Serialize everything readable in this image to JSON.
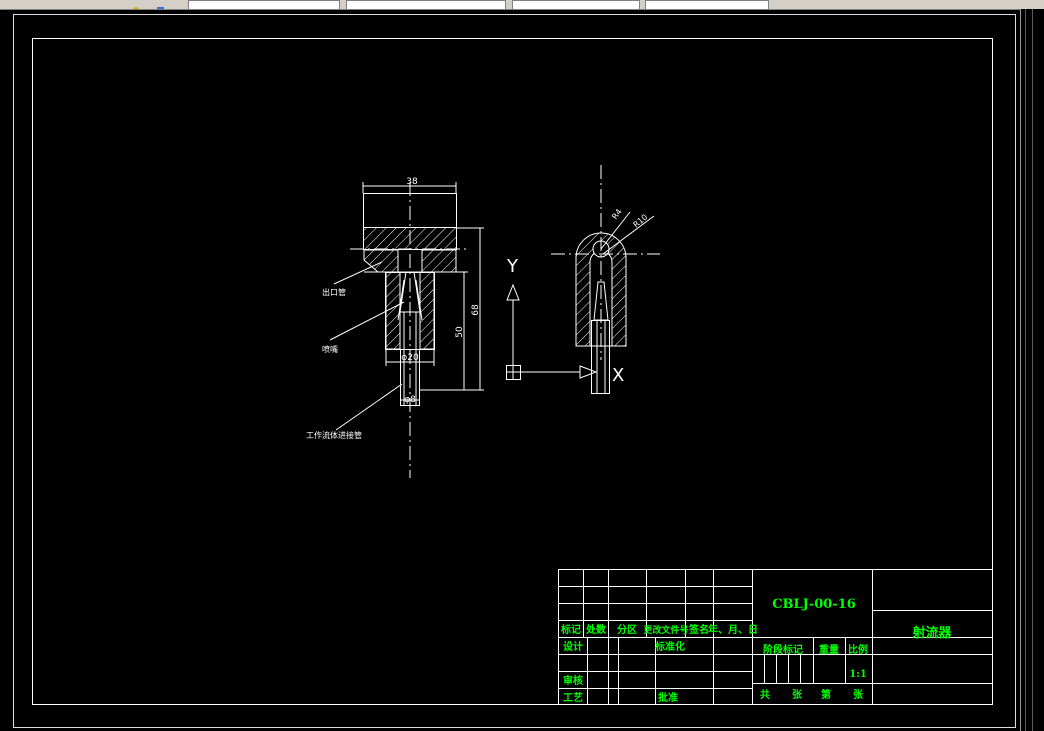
{
  "toolbar": {
    "icons": [
      "layer-icon",
      "toggle-icon"
    ]
  },
  "drawing": {
    "dimensions": {
      "width_top": "38",
      "height_total": "68",
      "height_body": "50",
      "dia_body": "φ20",
      "dia_pipe": "φ8",
      "radius_small": "R4",
      "radius_large": "R10"
    },
    "leaders": {
      "outlet_pipe": "出口管",
      "nozzle": "喷嘴",
      "fluid_inlet_pipe": "工作流体进接管"
    },
    "axes": {
      "y_label": "Y",
      "x_label": "X"
    }
  },
  "title_block": {
    "drawing_number": "CBLJ-00-16",
    "part_name": "射流器",
    "headers": [
      "标记",
      "处数",
      "分区",
      "更改文件号",
      "签名",
      "年、月、日"
    ],
    "row_design": "设计",
    "row_standard": "标准化",
    "row_review": "审核",
    "row_process": "工艺",
    "row_approve": "批准",
    "stage_mark": "阶段标记",
    "weight": "重量",
    "scale_label": "比例",
    "scale_value": "1:1",
    "sheets": [
      "共",
      "张",
      "第",
      "张"
    ]
  }
}
